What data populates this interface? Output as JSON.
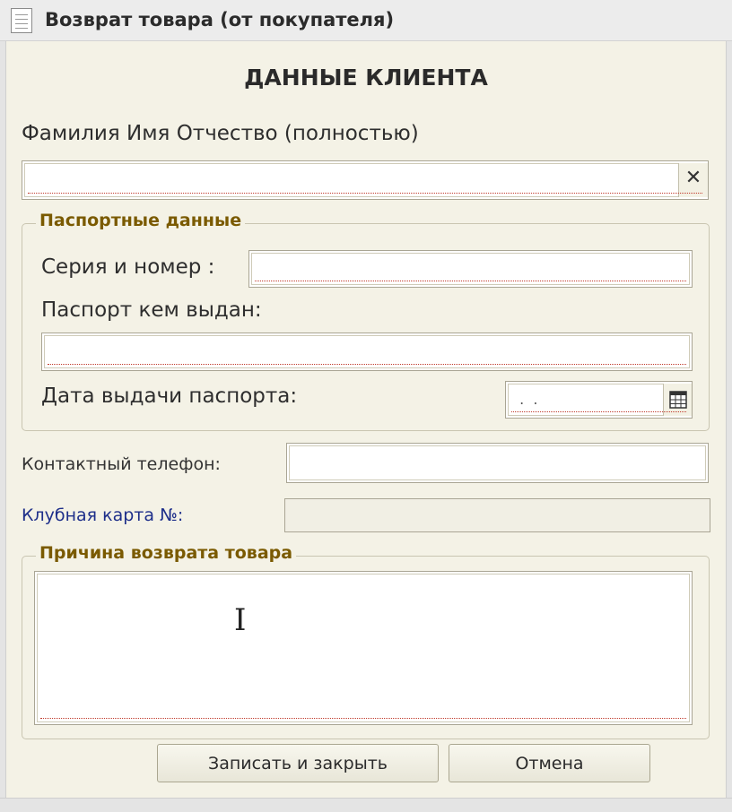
{
  "window": {
    "title": "Возврат товара (от покупателя)",
    "icon": "document-icon"
  },
  "form": {
    "heading": "ДАННЫЕ КЛИЕНТА",
    "full_name": {
      "label": "Фамилия Имя Отчество (полностью)",
      "value": "",
      "clear_glyph": "✕"
    },
    "passport_group": {
      "title": "Паспортные данные",
      "series_label": "Серия и номер :",
      "series_value": "",
      "issued_by_label": "Паспорт кем выдан:",
      "issued_by_value": "",
      "issue_date_label": "Дата выдачи паспорта:",
      "issue_date_value": " .  ."
    },
    "phone": {
      "label": "Контактный телефон:",
      "value": ""
    },
    "club_card": {
      "label": "Клубная карта №:",
      "value": ""
    },
    "reason_group": {
      "title": "Причина возврата товара",
      "value": ""
    }
  },
  "buttons": {
    "save_close": "Записать и закрыть",
    "cancel": "Отмена"
  },
  "colors": {
    "background": "#f4f2e6",
    "group_title": "#7a5a00",
    "link_label": "#1e2f8a",
    "required_underline": "#c0392b"
  }
}
